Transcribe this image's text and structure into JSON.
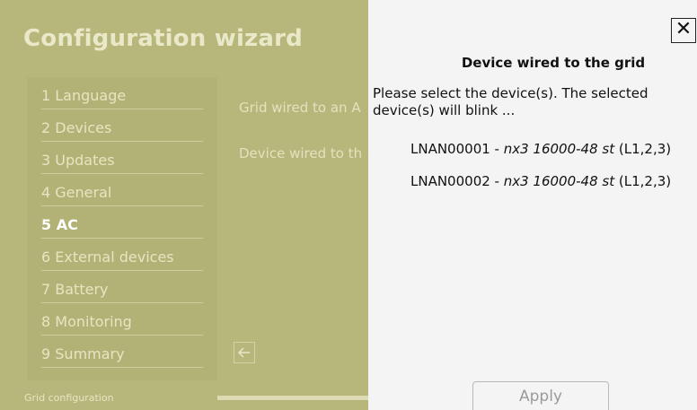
{
  "wizard": {
    "title": "Configuration wizard",
    "steps": [
      {
        "label": "1 Language",
        "active": false
      },
      {
        "label": "2 Devices",
        "active": false
      },
      {
        "label": "3 Updates",
        "active": false
      },
      {
        "label": "4 General",
        "active": false
      },
      {
        "label": "5 AC",
        "active": true
      },
      {
        "label": "6 External devices",
        "active": false
      },
      {
        "label": "7 Battery",
        "active": false
      },
      {
        "label": "8 Monitoring",
        "active": false
      },
      {
        "label": "9 Summary",
        "active": false
      }
    ],
    "main": {
      "line1": "Grid wired to an A",
      "line2": "Device wired to th"
    },
    "footer_label": "Grid configuration",
    "back_icon": "arrow-left-icon"
  },
  "dialog": {
    "close_icon": "close-icon",
    "close_glyph": "✕",
    "title": "Device wired to the grid",
    "description": "Please select the device(s). The selected device(s) will blink ...",
    "devices": [
      {
        "id": "LNAN00001",
        "separator": " - ",
        "model": "nx3 16000-48 st",
        "phases": " (L1,2,3)"
      },
      {
        "id": "LNAN00002",
        "separator": " - ",
        "model": "nx3 16000-48 st",
        "phases": " (L1,2,3)"
      }
    ],
    "apply_label": "Apply"
  },
  "colors": {
    "overlay_olive": "#b8b77b",
    "panel_bg": "#f4f4f4",
    "text_dark": "#111111"
  }
}
